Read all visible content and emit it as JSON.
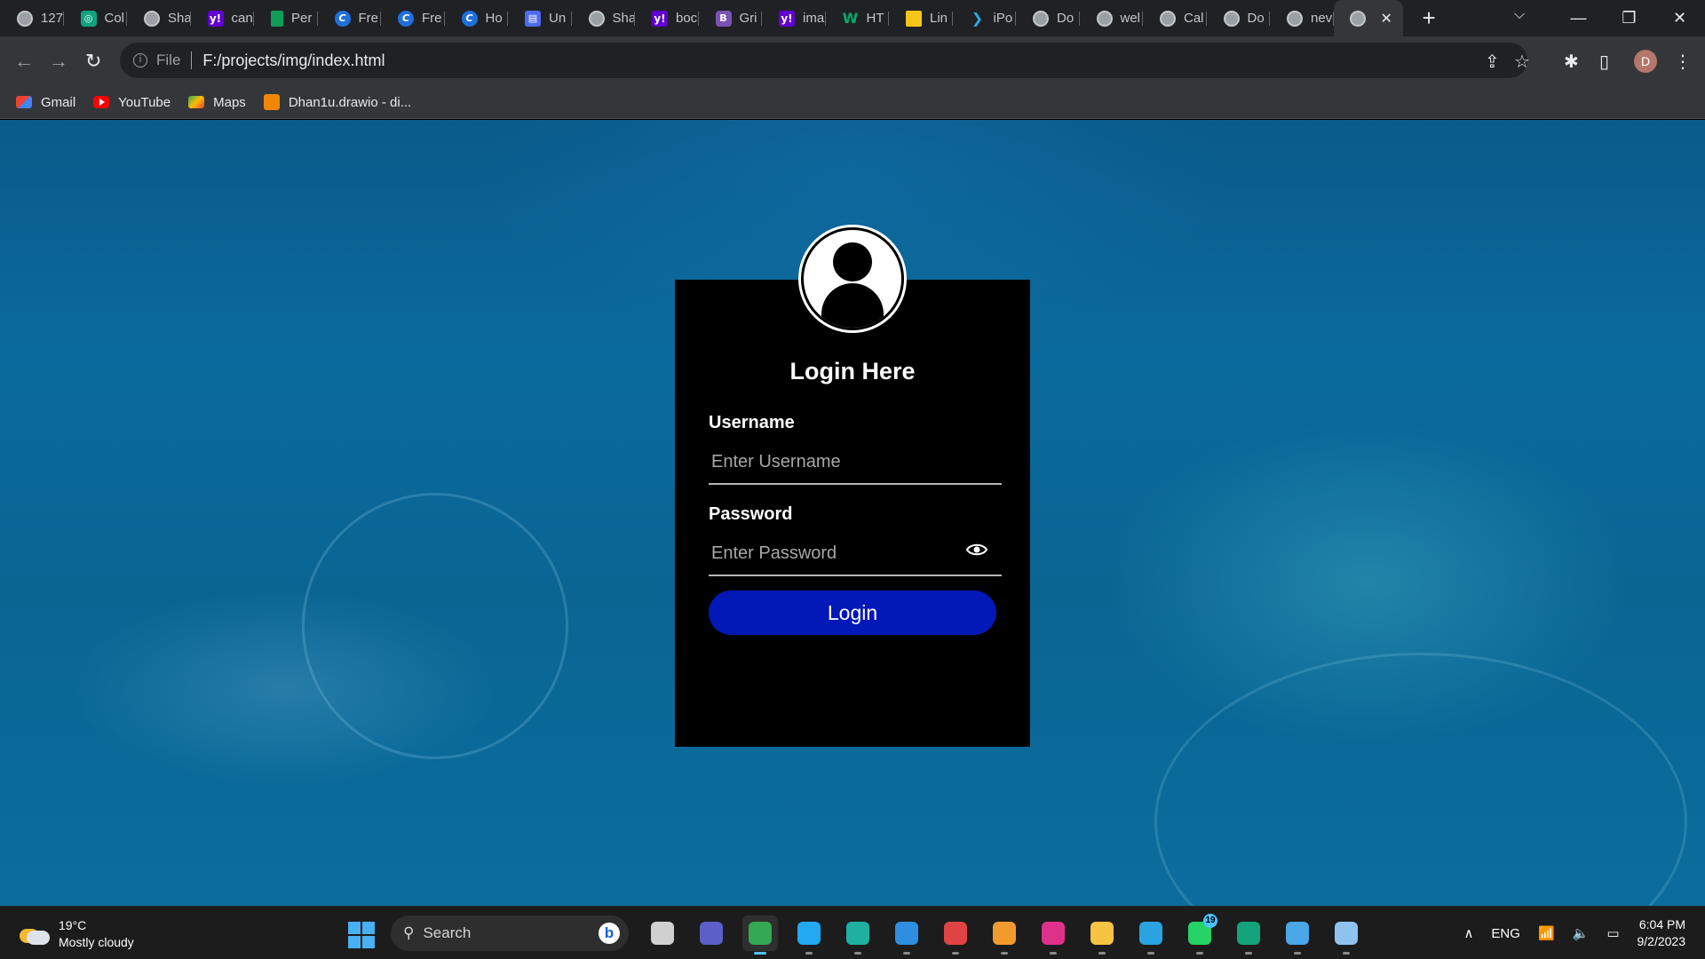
{
  "browser": {
    "tabs": [
      {
        "label": "127",
        "icon": "globe-icon",
        "fav": "globe",
        "glyph": ""
      },
      {
        "label": "Col",
        "icon": "chatgpt-icon",
        "fav": "gpt",
        "glyph": "◎"
      },
      {
        "label": "Sha",
        "icon": "globe-icon",
        "fav": "globe",
        "glyph": ""
      },
      {
        "label": "can",
        "icon": "yahoo-icon",
        "fav": "yahoo",
        "glyph": "y!"
      },
      {
        "label": "Per",
        "icon": "sheets-icon",
        "fav": "sheet",
        "glyph": ""
      },
      {
        "label": "Fre",
        "icon": "canva-icon",
        "fav": "canva",
        "glyph": "C"
      },
      {
        "label": "Fre",
        "icon": "canva-icon",
        "fav": "canva",
        "glyph": "C"
      },
      {
        "label": "Ho",
        "icon": "canva-icon",
        "fav": "canva",
        "glyph": "C"
      },
      {
        "label": "Un",
        "icon": "document-icon",
        "fav": "doc",
        "glyph": "▤"
      },
      {
        "label": "Sha",
        "icon": "globe-icon",
        "fav": "globe",
        "glyph": ""
      },
      {
        "label": "boc",
        "icon": "yahoo-icon",
        "fav": "yahoo",
        "glyph": "y!"
      },
      {
        "label": "Gri",
        "icon": "bootstrap-icon",
        "fav": "boot",
        "glyph": "B"
      },
      {
        "label": "ima",
        "icon": "yahoo-icon",
        "fav": "yahoo",
        "glyph": "y!"
      },
      {
        "label": "HT",
        "icon": "w3schools-icon",
        "fav": "w3",
        "glyph": "W"
      },
      {
        "label": "Lin",
        "icon": "linear-icon",
        "fav": "lin",
        "glyph": ""
      },
      {
        "label": "iPo",
        "icon": "ipo-icon",
        "fav": "ipo",
        "glyph": "❯"
      },
      {
        "label": "Do",
        "icon": "globe-icon",
        "fav": "globe",
        "glyph": ""
      },
      {
        "label": "wel",
        "icon": "globe-icon",
        "fav": "globe",
        "glyph": ""
      },
      {
        "label": "Cal",
        "icon": "globe-icon",
        "fav": "globe",
        "glyph": ""
      },
      {
        "label": "Do",
        "icon": "globe-icon",
        "fav": "globe",
        "glyph": ""
      },
      {
        "label": "nev",
        "icon": "globe-icon",
        "fav": "globe",
        "glyph": ""
      }
    ],
    "active_tab": {
      "label": "",
      "icon": "globe-icon"
    },
    "address": {
      "scheme_label": "File",
      "url": "F:/projects/img/index.html"
    },
    "profile_initial": "D",
    "bookmarks": [
      {
        "label": "Gmail",
        "icon": "gmail-icon",
        "fav": "gmail"
      },
      {
        "label": "YouTube",
        "icon": "youtube-icon",
        "fav": "yt"
      },
      {
        "label": "Maps",
        "icon": "maps-icon",
        "fav": "maps"
      },
      {
        "label": "Dhan1u.drawio - di...",
        "icon": "drawio-icon",
        "fav": "drawio"
      }
    ]
  },
  "login": {
    "title": "Login Here",
    "username_label": "Username",
    "username_placeholder": "Enter Username",
    "username_value": "",
    "password_label": "Password",
    "password_placeholder": "Enter Password",
    "password_value": "",
    "button_label": "Login",
    "accent": "#0218b7"
  },
  "taskbar": {
    "weather": {
      "temp": "19°C",
      "condition": "Mostly cloudy"
    },
    "search_placeholder": "Search",
    "apps": [
      {
        "name": "task-view-icon",
        "color": "#d0d0d0"
      },
      {
        "name": "teams-icon",
        "color": "#5b5fc7"
      },
      {
        "name": "chrome-icon",
        "color": "#34a853",
        "active": true
      },
      {
        "name": "vscode-icon",
        "color": "#23a8f2"
      },
      {
        "name": "edge-icon",
        "color": "#1fb0a2"
      },
      {
        "name": "mail-icon",
        "color": "#2f8ee0"
      },
      {
        "name": "record-icon",
        "color": "#e04343"
      },
      {
        "name": "sublime-icon",
        "color": "#f29a2e"
      },
      {
        "name": "wps-icon",
        "color": "#e0318a"
      },
      {
        "name": "file-explorer-icon",
        "color": "#f6c342"
      },
      {
        "name": "telegram-icon",
        "color": "#2aa3e0"
      },
      {
        "name": "whatsapp-icon",
        "color": "#25d366",
        "badge": "19"
      },
      {
        "name": "grammarly-icon",
        "color": "#15a37b"
      },
      {
        "name": "notepad-icon",
        "color": "#4aa7e8"
      },
      {
        "name": "paint-icon",
        "color": "#8fc2ef"
      }
    ],
    "language": "ENG",
    "time": "6:04 PM",
    "date": "9/2/2023"
  }
}
